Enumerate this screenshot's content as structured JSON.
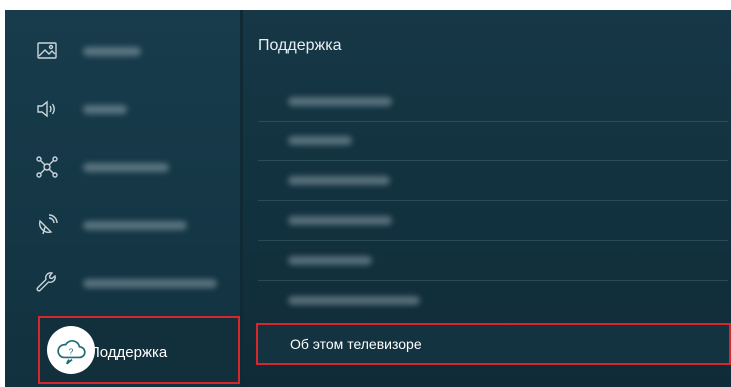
{
  "sidebar": {
    "items": [
      {
        "icon": "picture-icon",
        "label_blurred": true
      },
      {
        "icon": "sound-icon",
        "label_blurred": true
      },
      {
        "icon": "connection-icon",
        "label_blurred": true
      },
      {
        "icon": "broadcasting-icon",
        "label_blurred": true
      },
      {
        "icon": "wrench-icon",
        "label_blurred": true
      }
    ],
    "selected": {
      "icon": "support-cloud-icon",
      "label": "Поддержка"
    }
  },
  "panel": {
    "title": "Поддержка",
    "items_blurred_count": 6,
    "selected_item": "Об этом телевизоре"
  },
  "colors": {
    "background": "#163746",
    "highlight_border": "#d8262d",
    "text": "#ffffff"
  }
}
